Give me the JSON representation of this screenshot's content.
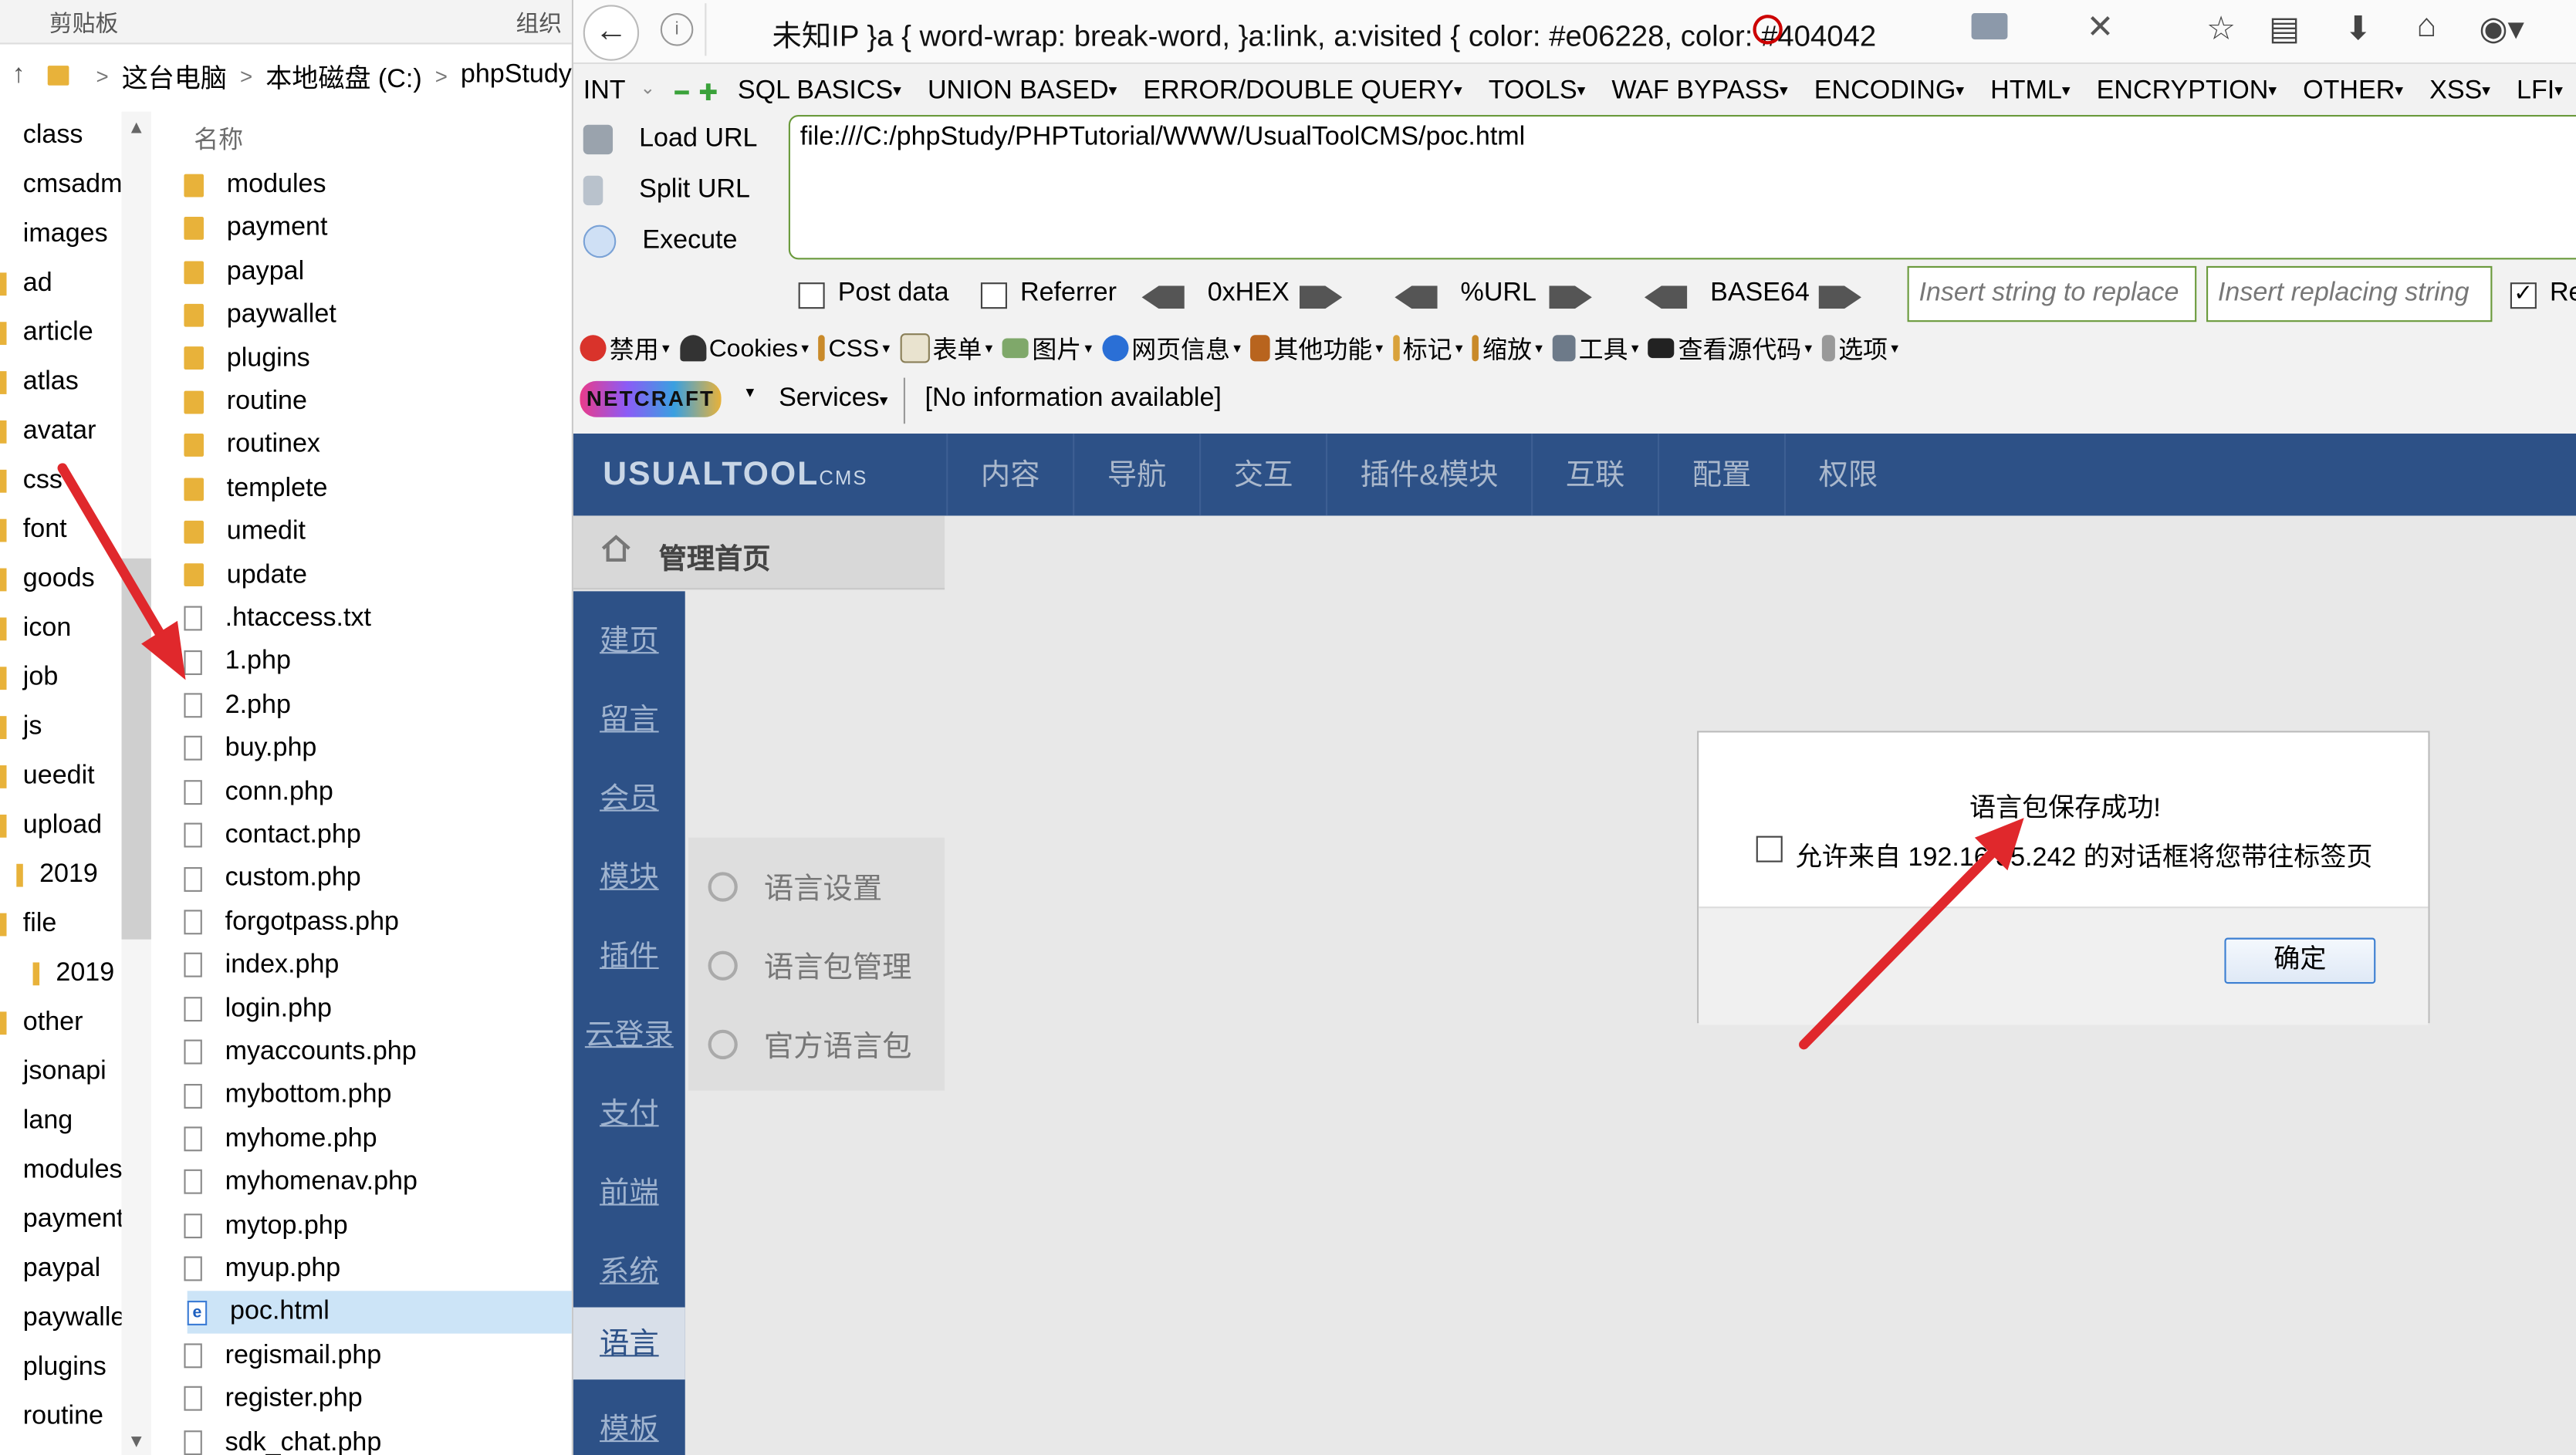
{
  "explorer": {
    "ribbon": {
      "left": "剪贴板",
      "right": "组织"
    },
    "address": {
      "crumbs": [
        "这台电脑",
        "本地磁盘 (C:)",
        "phpStudy"
      ]
    },
    "tree": [
      "class",
      "cmsadm",
      "images",
      "ad",
      "article",
      "atlas",
      "avatar",
      "css",
      "font",
      "goods",
      "icon",
      "job",
      "js",
      "ueedit",
      "upload",
      "2019",
      "file",
      "2019",
      "other",
      "jsonapi",
      "lang",
      "modules",
      "payment",
      "paypal",
      "paywalle",
      "plugins",
      "routine"
    ],
    "column_header": "名称",
    "files": [
      {
        "name": "modules",
        "type": "folder"
      },
      {
        "name": "payment",
        "type": "folder"
      },
      {
        "name": "paypal",
        "type": "folder"
      },
      {
        "name": "paywallet",
        "type": "folder"
      },
      {
        "name": "plugins",
        "type": "folder"
      },
      {
        "name": "routine",
        "type": "folder"
      },
      {
        "name": "routinex",
        "type": "folder"
      },
      {
        "name": "templete",
        "type": "folder"
      },
      {
        "name": "umedit",
        "type": "folder"
      },
      {
        "name": "update",
        "type": "folder"
      },
      {
        "name": ".htaccess.txt",
        "type": "file"
      },
      {
        "name": "1.php",
        "type": "file"
      },
      {
        "name": "2.php",
        "type": "file"
      },
      {
        "name": "buy.php",
        "type": "file"
      },
      {
        "name": "conn.php",
        "type": "file"
      },
      {
        "name": "contact.php",
        "type": "file"
      },
      {
        "name": "custom.php",
        "type": "file"
      },
      {
        "name": "forgotpass.php",
        "type": "file"
      },
      {
        "name": "index.php",
        "type": "file"
      },
      {
        "name": "login.php",
        "type": "file"
      },
      {
        "name": "myaccounts.php",
        "type": "file"
      },
      {
        "name": "mybottom.php",
        "type": "file"
      },
      {
        "name": "myhome.php",
        "type": "file"
      },
      {
        "name": "myhomenav.php",
        "type": "file"
      },
      {
        "name": "mytop.php",
        "type": "file"
      },
      {
        "name": "myup.php",
        "type": "file"
      },
      {
        "name": "poc.html",
        "type": "html",
        "selected": true
      },
      {
        "name": "regismail.php",
        "type": "file"
      },
      {
        "name": "register.php",
        "type": "file"
      },
      {
        "name": "sdk_chat.php",
        "type": "file"
      }
    ]
  },
  "browser": {
    "tab_title": "未知IP   }a { word-wrap: break-word, }a:link, a:visited { color: #e06228, color: #404042",
    "hackbar": {
      "select_value": "INT",
      "menus": [
        "SQL BASICS",
        "UNION BASED",
        "ERROR/DOUBLE QUERY",
        "TOOLS",
        "WAF BYPASS",
        "ENCODING",
        "HTML",
        "ENCRYPTION",
        "OTHER",
        "XSS",
        "LFI"
      ],
      "load_url": "Load URL",
      "split_url": "Split URL",
      "execute": "Execute",
      "url_value": "file:///C:/phpStudy/PHPTutorial/WWW/UsualToolCMS/poc.html",
      "post_data": "Post data",
      "referrer": "Referrer",
      "hex": "0xHEX",
      "url_enc": "%URL",
      "base64": "BASE64",
      "replace_placeholder": "Insert string to replace",
      "replacing_placeholder": "Insert replacing string",
      "re_label": "Re"
    },
    "toolbar_cn": [
      "禁用",
      "Cookies",
      "CSS",
      "表单",
      "图片",
      "网页信息",
      "其他功能",
      "标记",
      "缩放",
      "工具",
      "查看源代码",
      "选项"
    ],
    "netcraft": {
      "logo": "NETCRAFT",
      "services": "Services",
      "info": "[No information available]"
    }
  },
  "cms": {
    "logo": "USUALTOOL",
    "logo_suffix": "CMS",
    "nav": [
      "内容",
      "导航",
      "交互",
      "插件&模块",
      "互联",
      "配置",
      "权限"
    ],
    "home": "管理首页",
    "side": [
      "建页",
      "留言",
      "会员",
      "模块",
      "插件",
      "云登录",
      "支付",
      "前端",
      "系统",
      "语言",
      "模板"
    ],
    "active_side": "语言",
    "sub": [
      "语言设置",
      "语言包管理",
      "官方语言包"
    ]
  },
  "dialog": {
    "message": "语言包保存成功!",
    "checkbox_label": "允许来自 192.16     35.242 的对话框将您带往标签页",
    "ok": "确定"
  }
}
